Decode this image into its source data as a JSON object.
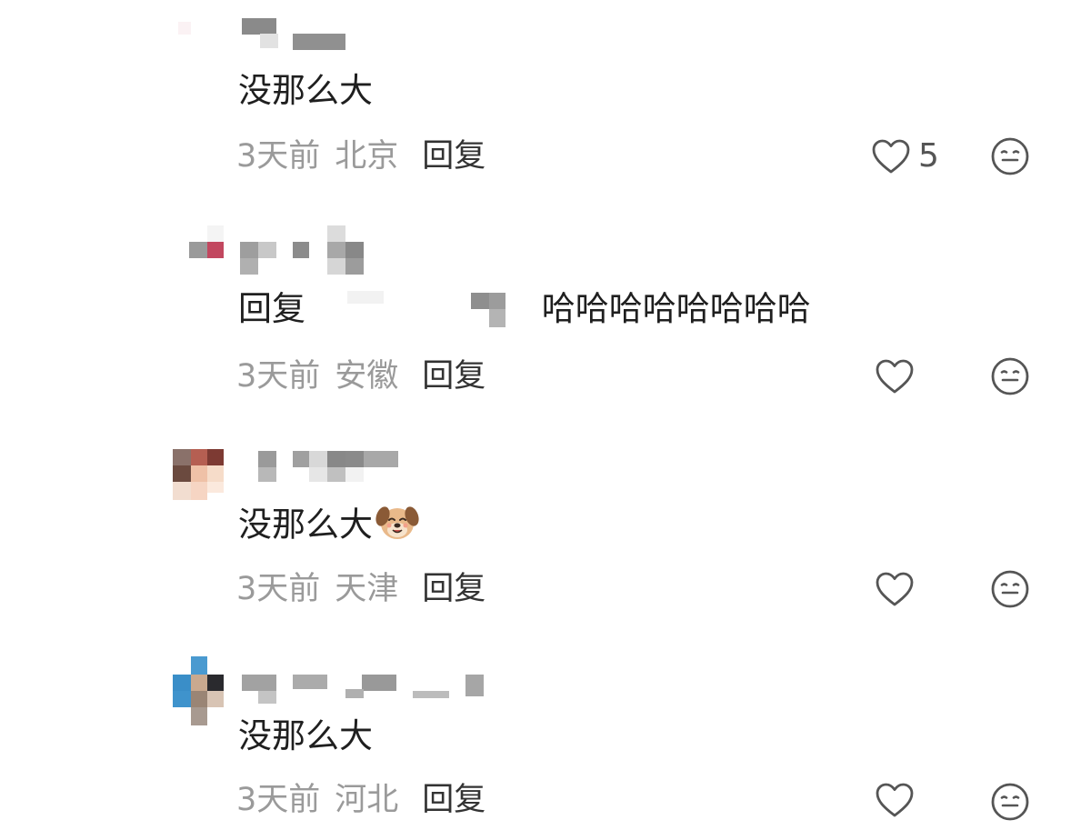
{
  "comments": [
    {
      "text": "没那么大",
      "time": "3天前",
      "location": "北京",
      "reply_label": "回复",
      "likes": "5"
    },
    {
      "reply_prefix": "回复",
      "text": "哈哈哈哈哈哈哈哈",
      "time": "3天前",
      "location": "安徽",
      "reply_label": "回复",
      "likes": ""
    },
    {
      "text": "没那么大",
      "emoji": "dog-emoji",
      "time": "3天前",
      "location": "天津",
      "reply_label": "回复",
      "likes": ""
    },
    {
      "text": "没那么大",
      "time": "3天前",
      "location": "河北",
      "reply_label": "回复",
      "likes": ""
    }
  ],
  "icons": {
    "like": "heart-outline-icon",
    "dislike": "neutral-face-icon"
  },
  "colors": {
    "text": "#1f1f1f",
    "meta": "#9a9a9a",
    "reply": "#333333",
    "icon": "#555555"
  }
}
